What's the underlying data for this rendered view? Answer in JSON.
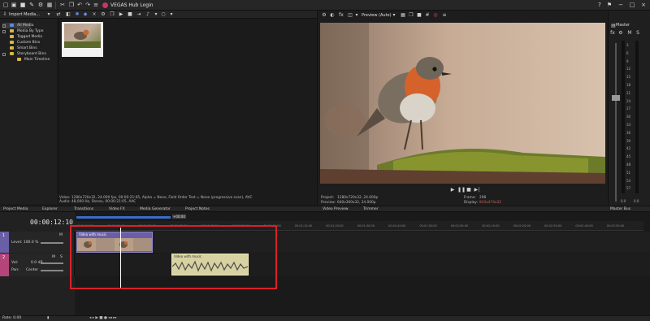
{
  "app": {
    "title": "VEGAS Hub Login"
  },
  "toolbar": {
    "icons": [
      "new-icon",
      "open-icon",
      "save-icon",
      "edit-icon",
      "settings-icon",
      "undo-icon",
      "redo-icon",
      "hub-logo-icon",
      "help-icon",
      "notification-icon",
      "minimize-icon",
      "maximize-icon",
      "close-icon"
    ]
  },
  "media": {
    "dropdown_label": "Import Media...",
    "tree": [
      {
        "label": "All Media",
        "selected": true
      },
      {
        "label": "Media By Type"
      },
      {
        "label": "Tagged Media"
      },
      {
        "label": "Custom Bins"
      },
      {
        "label": "Smart Bins"
      },
      {
        "label": "Storyboard Bins"
      },
      {
        "label": "Main Timeline"
      }
    ],
    "info_line1": "Video: 1280x720x32, 24.000 fps, 00:00:21:05, Alpha = None, Field Order Test = None (progressive scan), AVC",
    "info_line2": "Audio: 48,000 Hz, Stereo, 00:00:21:05, AAC"
  },
  "preview": {
    "mode_label": "Preview (Auto)",
    "project_label": "Project:",
    "project_value": "1280x720x32, 24.000p",
    "preview_label": "Preview:",
    "preview_value": "640x360x32, 24.000p",
    "frame_label": "Frame:",
    "frame_value": "298",
    "display_label": "Display:",
    "display_value": "843x474x32"
  },
  "master": {
    "label": "Master",
    "scale": [
      "3",
      "6",
      "9",
      "12",
      "15",
      "18",
      "21",
      "24",
      "27",
      "30",
      "33",
      "36",
      "39",
      "42",
      "45",
      "48",
      "51",
      "54",
      "57"
    ],
    "readout_left": "0.0",
    "readout_right": "0.0"
  },
  "tabs": {
    "left": [
      {
        "label": "Project Media"
      },
      {
        "label": "Explorer"
      },
      {
        "label": "Transitions"
      },
      {
        "label": "Video FX"
      },
      {
        "label": "Media Generator"
      },
      {
        "label": "Project Notes"
      }
    ],
    "video_preview": "Video Preview",
    "trimmer": "Trimmer",
    "master_bus": "Master Bus"
  },
  "timeline": {
    "timecode": "00:00:12:10",
    "ruler_labels": [
      "00:00:00:00",
      "00:00:10:00",
      "00:00:20:00",
      "00:00:30:00",
      "00:00:40:00",
      "00:00:50:00",
      "00:01:00:00",
      "00:01:10:00",
      "00:01:20:00",
      "00:01:30:00",
      "00:01:40:00",
      "00:01:50:00",
      "00:02:00:00",
      "00:02:10:00",
      "00:02:20:00",
      "00:02:30:00",
      "00:02:40:00",
      "00:02:50:00"
    ],
    "video_track": {
      "number": "1",
      "level_label": "Level: 100.0 %",
      "m": "M",
      "s": "S"
    },
    "audio_track": {
      "number": "2",
      "vol_label": "Vol:",
      "vol_value": "0.0 dB",
      "pan_label": "Pan:",
      "pan_value": "Center",
      "m": "M",
      "s": "S"
    },
    "video_clip_title": "Video with music",
    "audio_clip_title": "Video with music",
    "loop_marker": "+00:00"
  },
  "status": {
    "rate": "Rate: 0.00"
  },
  "colors": {
    "highlight": "#d9212b",
    "video_clip": "#6a5fa6",
    "audio_clip": "#d8d2a2",
    "accent": "#3b6cc8"
  }
}
